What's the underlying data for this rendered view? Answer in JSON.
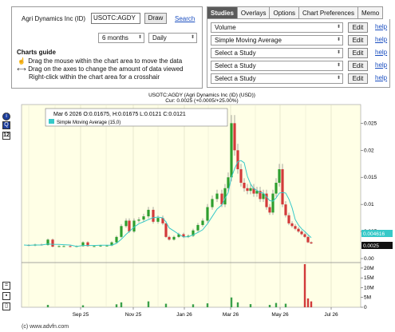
{
  "controls": {
    "symbol_label": "Agri Dynamics Inc (ID)",
    "symbol_value": "USOTC:AGDY",
    "draw_label": "Draw",
    "search_label": "Search",
    "period": "6 months",
    "interval": "Daily"
  },
  "guide": {
    "title": "Charts guide",
    "lines": [
      "Drag the mouse within the chart area to move the data",
      "Drag on the axes to change the amount of data viewed",
      "Right-click within the chart area for a crosshair"
    ]
  },
  "tabs": [
    "Studies",
    "Overlays",
    "Options",
    "Chart Preferences",
    "Memo"
  ],
  "studies": [
    {
      "value": "Volume",
      "edit": "Edit",
      "help": "help"
    },
    {
      "value": "Simple Moving Average",
      "edit": "Edit",
      "help": "help"
    },
    {
      "value": "Select a Study",
      "edit": "Edit",
      "help": "help"
    },
    {
      "value": "Select a Study",
      "edit": "Edit",
      "help": "help"
    },
    {
      "value": "Select a Study",
      "edit": "Edit",
      "help": "help"
    }
  ],
  "tools": [
    "i",
    "Q",
    "12",
    "=",
    "▪",
    "▯"
  ],
  "chart": {
    "title": "USOTC:AGDY (Agri Dynamics Inc (ID) (USD))",
    "subtitle": "Cur: 0.0025 (+0.0005/+25.00%)",
    "info_line": "Mar 6 2026  O:0.01675,  H:0.01675  L:0.0121  C:0.0121",
    "legend": "Simple Moving Average (15,0)",
    "price_ticks": [
      "0.025",
      "0.02",
      "0.015",
      "0.01",
      "0.005",
      "0.00"
    ],
    "volume_ticks": [
      "20M",
      "15M",
      "10M",
      "5M",
      "0"
    ],
    "x_ticks": [
      "Sep 25",
      "Nov 25",
      "Jan 26",
      "Mar 26",
      "May 26",
      "Jul 26"
    ],
    "last_badge": "0.004616",
    "close_badge": "0.0025",
    "copyright": "(c) www.advfn.com",
    "colors": {
      "plot_bg": "#ffffe6",
      "sma": "#36c9c8",
      "up": "#2e9e2e",
      "down": "#d23a3a",
      "badge_sma": "#36c9c8",
      "badge_close": "#111111"
    }
  }
}
